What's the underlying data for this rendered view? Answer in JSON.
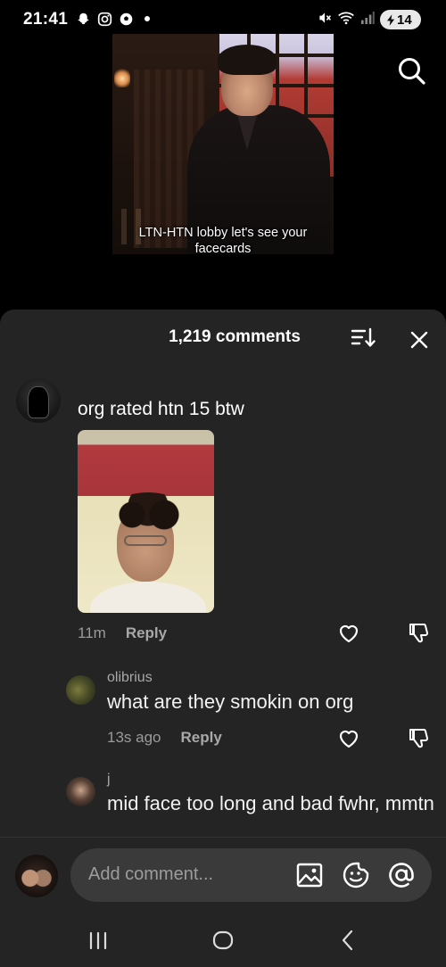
{
  "status_bar": {
    "time": "21:41",
    "battery": "14"
  },
  "video": {
    "caption": "LTN-HTN lobby let's see your facecards"
  },
  "comments_sheet": {
    "count_label": "1,219 comments",
    "comments": [
      {
        "text": "org rated htn 15 btw",
        "time": "11m",
        "reply_label": "Reply"
      }
    ],
    "replies": [
      {
        "username": "olibrius",
        "text": "what are they smokin on org",
        "time": "13s ago",
        "reply_label": "Reply"
      },
      {
        "username": "j",
        "text": "mid face too long and bad fwhr, mmtn"
      }
    ]
  },
  "composer": {
    "placeholder": "Add comment..."
  },
  "icons": {
    "search": "search-icon",
    "sort": "sort-icon",
    "close": "close-icon",
    "heart": "heart-icon",
    "dislike": "dislike-icon",
    "image": "image-icon",
    "emoji": "emoji-icon",
    "mention": "mention-icon"
  }
}
